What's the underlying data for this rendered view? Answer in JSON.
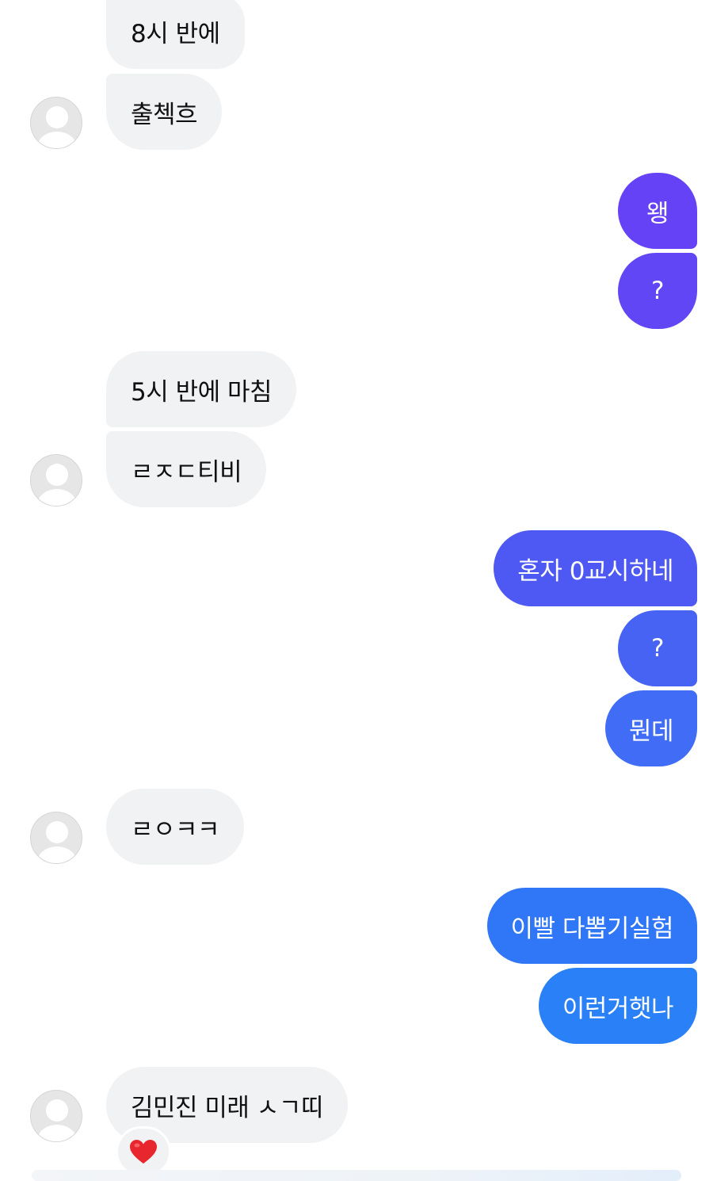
{
  "colors": {
    "incoming_bubble": "#f1f2f4",
    "outgoing_purple": "#6445f6",
    "outgoing_indigo": "#4a5cf3",
    "outgoing_blue": "#2f7cf6",
    "avatar_placeholder": "#e6e6e6"
  },
  "messages": [
    {
      "direction": "in",
      "text": "8시 반에"
    },
    {
      "direction": "in",
      "text": "출첵흐"
    },
    {
      "direction": "out",
      "text": "왱"
    },
    {
      "direction": "out",
      "text": "?"
    },
    {
      "direction": "in",
      "text": "5시 반에 마침"
    },
    {
      "direction": "in",
      "text": "ㄹㅈㄷ티비"
    },
    {
      "direction": "out",
      "text": "혼자 0교시하네"
    },
    {
      "direction": "out",
      "text": "?"
    },
    {
      "direction": "out",
      "text": "뭔데"
    },
    {
      "direction": "in",
      "text": "ㄹㅇㅋㅋ"
    },
    {
      "direction": "out",
      "text": "이빨 다뽑기실험"
    },
    {
      "direction": "out",
      "text": "이런거햇나"
    },
    {
      "direction": "in",
      "text": "김민진 미래 ㅅㄱ띠"
    }
  ],
  "reaction": {
    "icon": "heart-icon",
    "color": "#e8262d"
  }
}
